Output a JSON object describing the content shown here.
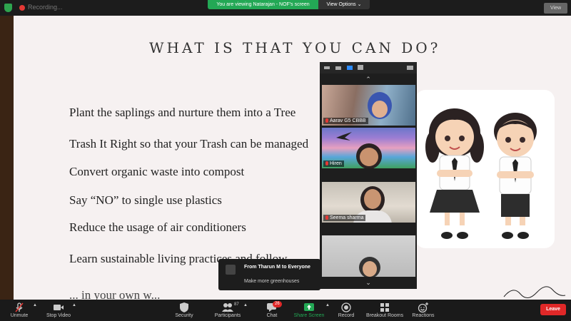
{
  "topbar": {
    "recording_text": "Recording...",
    "viewing_banner": "You are viewing Natarajan - NOF's screen",
    "view_options_label": "View Options ⌄",
    "view_button_label": "View"
  },
  "slide": {
    "title": "WHAT IS THAT YOU CAN DO?",
    "bullets": [
      "Plant the saplings and nurture them into a Tree",
      "Trash It Right so that your Trash can be managed",
      "Convert organic waste into compost",
      "Say “NO” to single use plastics",
      "Reduce the usage of air conditioners",
      "Learn sustainable living practices and follow",
      "... in your own w..."
    ]
  },
  "video_panel": {
    "participants": [
      {
        "name": "Aarav G5 CBBB"
      },
      {
        "name": "Hiren"
      },
      {
        "name": "Seema sharma"
      },
      {
        "name": ""
      }
    ]
  },
  "chat_popup": {
    "from": "From Tharun M to Everyone",
    "message": "Make more greenhouses"
  },
  "toolbar": {
    "unmute": "Unmute",
    "stop_video": "Stop Video",
    "security": "Security",
    "participants": "Participants",
    "participants_count": "87",
    "chat": "Chat",
    "chat_badge": "26",
    "share_screen": "Share Screen",
    "record": "Record",
    "breakout_rooms": "Breakout Rooms",
    "reactions": "Reactions",
    "leave": "Leave"
  },
  "colors": {
    "share_green": "#23a855",
    "leave_red": "#e02828",
    "active_blue": "#2d8cff"
  }
}
